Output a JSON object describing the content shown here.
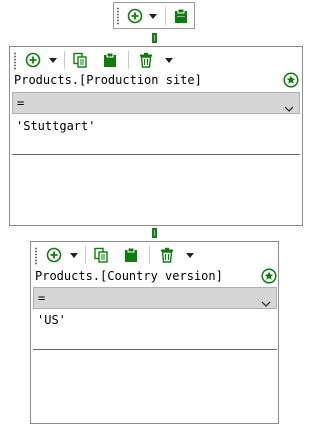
{
  "colors": {
    "accent": "#1a7a1a",
    "icon_green": "#107c10",
    "operator_bg": "#d6d6d6"
  },
  "toolbar_top": {
    "icons": [
      "grip-icon",
      "add-icon",
      "dropdown-arrow-icon",
      "clipboard-paste-icon"
    ]
  },
  "filters": [
    {
      "field": "Products.[Production site]",
      "operator": "=",
      "value": "'Stuttgart'",
      "icons": [
        "add-icon",
        "dropdown-arrow-icon",
        "copy-icon",
        "paste-icon",
        "delete-icon",
        "dropdown-arrow-icon",
        "favorite-star-icon"
      ]
    },
    {
      "field": "Products.[Country version]",
      "operator": "=",
      "value": "'US'",
      "icons": [
        "add-icon",
        "dropdown-arrow-icon",
        "copy-icon",
        "paste-icon",
        "delete-icon",
        "dropdown-arrow-icon",
        "favorite-star-icon"
      ]
    }
  ]
}
